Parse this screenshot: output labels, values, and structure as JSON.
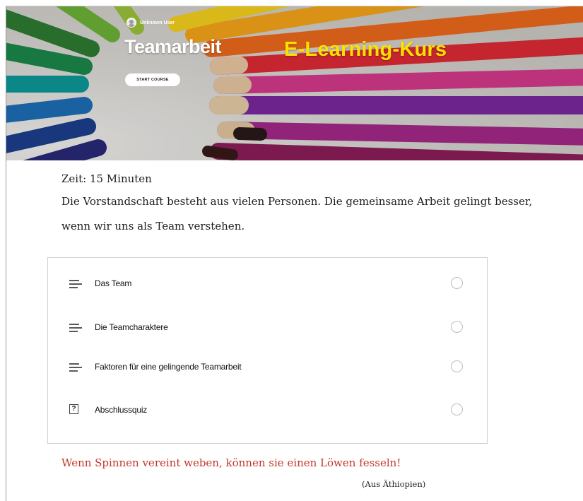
{
  "hero": {
    "user_name": "Unknown User",
    "title": "Teamarbeit",
    "subtitle": "E-Learning-Kurs",
    "start_button_label": "START COURSE",
    "colors": {
      "title": "#ffffff",
      "subtitle": "#ffe000"
    }
  },
  "intro": {
    "time": "Zeit: 15 Minuten",
    "description": "Die Vorstandschaft besteht aus vielen Personen. Die gemeinsame Arbeit gelingt besser, wenn wir uns als Team verstehen."
  },
  "lessons": [
    {
      "title": "Das Team",
      "icon": "text-lines-icon",
      "status": "not-started"
    },
    {
      "title": "Die Teamcharaktere",
      "icon": "text-lines-icon",
      "status": "not-started"
    },
    {
      "title": "Faktoren für eine gelingende Teamarbeit",
      "icon": "text-lines-icon",
      "status": "not-started"
    },
    {
      "title": "Abschlussquiz",
      "icon": "quiz-icon",
      "status": "not-started"
    }
  ],
  "quote": {
    "text": "Wenn Spinnen vereint weben, können sie einen Löwen fesseln!",
    "origin": "(Aus Äthiopien)",
    "color": "#c0392b"
  }
}
